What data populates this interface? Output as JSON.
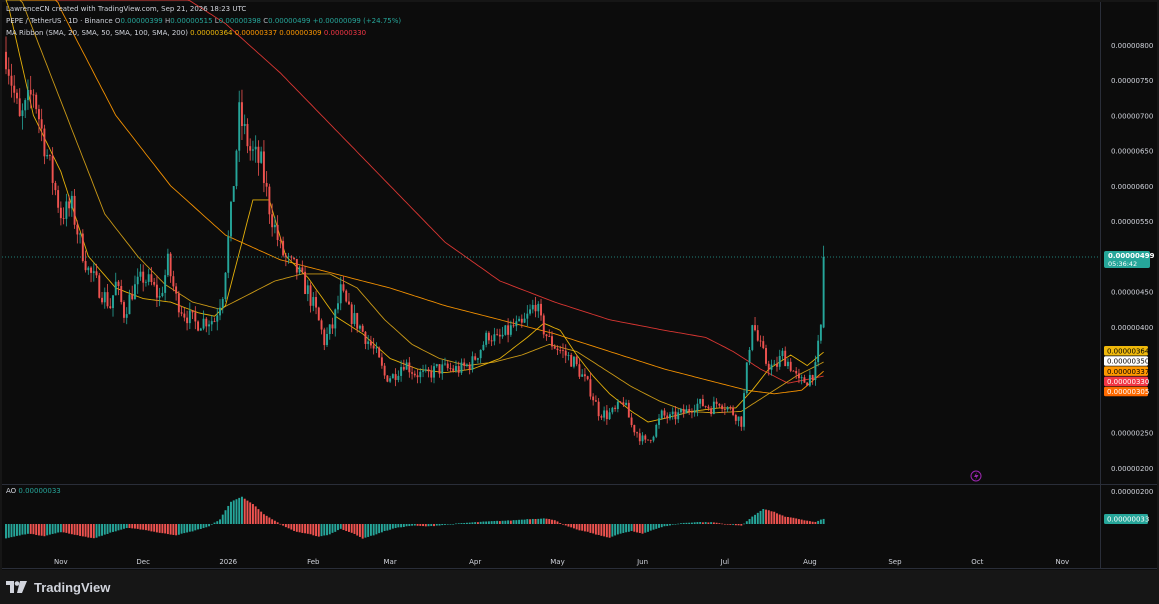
{
  "header": {
    "credit": "LawrenceCN created with TradingView.com, Sep 21, 2026 18:23 UTC",
    "symbol": "PEPE / TetherUS · 1D · Binance",
    "o_label": "O",
    "o_value": "0.00000399",
    "h_label": "H",
    "h_value": "0.00000515",
    "l_label": "L",
    "l_value": "0.00000398",
    "c_label": "C",
    "c_value": "0.00000499",
    "change": "+0.00000099 (+24.75%)",
    "ribbon_name": "MA Ribbon (SMA, 20, SMA, 50, SMA, 100, SMA, 200)",
    "ribbon_v1": "0.00000364",
    "ribbon_v2": "0.00000337",
    "ribbon_v3": "0.00000309",
    "ribbon_v4": "0.00000330"
  },
  "ao": {
    "name": "AO",
    "value": "0.00000033"
  },
  "price_badge": {
    "price": "0.00000499",
    "countdown": "05:36:42"
  },
  "ma_badges": [
    {
      "text": "0.00000364",
      "color": "#f0b90b",
      "price": 3.64
    },
    {
      "text": "0.00000350",
      "color": "#ffffff",
      "price": 3.5
    },
    {
      "text": "0.00000337",
      "color": "#ff9800",
      "price": 3.37
    },
    {
      "text": "0.00000330",
      "color": "#f23645",
      "price": 3.3
    },
    {
      "text": "0.00000305",
      "color": "#ff6a00",
      "price": 3.05
    }
  ],
  "ao_badge": "0.00000033",
  "ao_axis_label": "0.00000200",
  "footer": {
    "brand": "TradingView"
  },
  "colors": {
    "up": "#26a69a",
    "down": "#ef5350",
    "ma20": "#f0b90b",
    "ma50": "#d4a017",
    "ma100": "#ff9800",
    "ma200": "#e53935"
  },
  "chart_data": {
    "type": "candlestick",
    "ylim": [
      1.9,
      8.5
    ],
    "y_unit_note": "prices in units of 0.000001",
    "yticks": [
      {
        "v": 8.0,
        "label": "0.00000800"
      },
      {
        "v": 7.5,
        "label": "0.00000750"
      },
      {
        "v": 7.0,
        "label": "0.00000700"
      },
      {
        "v": 6.5,
        "label": "0.00000650"
      },
      {
        "v": 6.0,
        "label": "0.00000600"
      },
      {
        "v": 5.5,
        "label": "0.00000550"
      },
      {
        "v": 4.5,
        "label": "0.00000450"
      },
      {
        "v": 4.0,
        "label": "0.00000400"
      },
      {
        "v": 2.5,
        "label": "0.00000250"
      },
      {
        "v": 2.0,
        "label": "0.00000200"
      }
    ],
    "xticks": [
      {
        "d": 20,
        "label": "Nov"
      },
      {
        "d": 50,
        "label": "Dec"
      },
      {
        "d": 81,
        "label": "2026"
      },
      {
        "d": 112,
        "label": "Feb"
      },
      {
        "d": 140,
        "label": "Mar"
      },
      {
        "d": 171,
        "label": "Apr"
      },
      {
        "d": 201,
        "label": "May"
      },
      {
        "d": 232,
        "label": "Jun"
      },
      {
        "d": 262,
        "label": "Jul"
      },
      {
        "d": 293,
        "label": "Aug"
      },
      {
        "d": 324,
        "label": "Sep"
      },
      {
        "d": 354,
        "label": "Oct"
      },
      {
        "d": 385,
        "label": "Nov"
      }
    ],
    "price_anchors": [
      [
        0,
        7.9
      ],
      [
        5,
        6.9
      ],
      [
        10,
        7.35
      ],
      [
        14,
        6.6
      ],
      [
        17,
        6.1
      ],
      [
        20,
        5.6
      ],
      [
        24,
        5.7
      ],
      [
        27,
        5.2
      ],
      [
        30,
        4.8
      ],
      [
        34,
        4.55
      ],
      [
        38,
        4.3
      ],
      [
        40,
        4.6
      ],
      [
        43,
        4.2
      ],
      [
        46,
        4.5
      ],
      [
        50,
        4.7
      ],
      [
        53,
        4.6
      ],
      [
        56,
        4.4
      ],
      [
        59,
        4.9
      ],
      [
        62,
        4.4
      ],
      [
        65,
        4.2
      ],
      [
        69,
        4.05
      ],
      [
        73,
        4.1
      ],
      [
        76,
        4.1
      ],
      [
        79,
        4.5
      ],
      [
        82,
        5.6
      ],
      [
        85,
        7.0
      ],
      [
        89,
        6.5
      ],
      [
        93,
        6.3
      ],
      [
        96,
        5.7
      ],
      [
        100,
        5.1
      ],
      [
        103,
        4.9
      ],
      [
        106,
        4.8
      ],
      [
        110,
        4.5
      ],
      [
        113,
        4.2
      ],
      [
        116,
        3.8
      ],
      [
        119,
        4.0
      ],
      [
        122,
        4.5
      ],
      [
        125,
        4.2
      ],
      [
        129,
        4.0
      ],
      [
        132,
        3.8
      ],
      [
        135,
        3.6
      ],
      [
        138,
        3.3
      ],
      [
        141,
        3.3
      ],
      [
        145,
        3.5
      ],
      [
        149,
        3.35
      ],
      [
        153,
        3.3
      ],
      [
        157,
        3.4
      ],
      [
        162,
        3.4
      ],
      [
        166,
        3.4
      ],
      [
        170,
        3.5
      ],
      [
        173,
        3.7
      ],
      [
        176,
        3.9
      ],
      [
        179,
        3.8
      ],
      [
        182,
        3.9
      ],
      [
        185,
        4.0
      ],
      [
        188,
        4.0
      ],
      [
        191,
        4.2
      ],
      [
        193,
        4.35
      ],
      [
        195,
        4.05
      ],
      [
        198,
        3.8
      ],
      [
        201,
        3.7
      ],
      [
        204,
        3.6
      ],
      [
        207,
        3.5
      ],
      [
        210,
        3.3
      ],
      [
        213,
        3.1
      ],
      [
        216,
        2.8
      ],
      [
        219,
        2.75
      ],
      [
        222,
        2.8
      ],
      [
        225,
        2.95
      ],
      [
        228,
        2.6
      ],
      [
        231,
        2.45
      ],
      [
        233,
        2.35
      ],
      [
        236,
        2.5
      ],
      [
        239,
        2.75
      ],
      [
        242,
        2.7
      ],
      [
        245,
        2.75
      ],
      [
        248,
        2.8
      ],
      [
        251,
        2.9
      ],
      [
        254,
        2.9
      ],
      [
        257,
        2.85
      ],
      [
        260,
        2.95
      ],
      [
        263,
        2.85
      ],
      [
        266,
        2.75
      ],
      [
        268,
        2.65
      ],
      [
        270,
        3.4
      ],
      [
        272,
        4.1
      ],
      [
        274,
        3.8
      ],
      [
        277,
        3.5
      ],
      [
        280,
        3.4
      ],
      [
        283,
        3.6
      ],
      [
        286,
        3.45
      ],
      [
        289,
        3.2
      ],
      [
        292,
        3.25
      ],
      [
        295,
        3.4
      ],
      [
        297,
        4.0
      ],
      [
        298,
        4.99
      ]
    ],
    "ma20_anchors": [
      [
        0,
        8.7
      ],
      [
        10,
        7.0
      ],
      [
        20,
        6.2
      ],
      [
        30,
        5.0
      ],
      [
        40,
        4.55
      ],
      [
        50,
        4.4
      ],
      [
        60,
        4.35
      ],
      [
        70,
        4.2
      ],
      [
        76,
        4.15
      ],
      [
        80,
        4.3
      ],
      [
        86,
        5.2
      ],
      [
        90,
        5.8
      ],
      [
        96,
        5.8
      ],
      [
        102,
        5.0
      ],
      [
        110,
        4.7
      ],
      [
        120,
        4.15
      ],
      [
        130,
        3.9
      ],
      [
        140,
        3.55
      ],
      [
        150,
        3.4
      ],
      [
        160,
        3.35
      ],
      [
        170,
        3.4
      ],
      [
        180,
        3.55
      ],
      [
        190,
        3.85
      ],
      [
        196,
        4.05
      ],
      [
        202,
        3.95
      ],
      [
        208,
        3.6
      ],
      [
        214,
        3.3
      ],
      [
        220,
        3.05
      ],
      [
        228,
        2.8
      ],
      [
        234,
        2.65
      ],
      [
        240,
        2.7
      ],
      [
        250,
        2.8
      ],
      [
        260,
        2.85
      ],
      [
        266,
        2.85
      ],
      [
        272,
        3.1
      ],
      [
        278,
        3.4
      ],
      [
        286,
        3.6
      ],
      [
        292,
        3.45
      ],
      [
        298,
        3.64
      ]
    ],
    "ma50_anchors": [
      [
        0,
        9.2
      ],
      [
        12,
        8.0
      ],
      [
        24,
        6.8
      ],
      [
        36,
        5.6
      ],
      [
        48,
        5.0
      ],
      [
        58,
        4.6
      ],
      [
        68,
        4.35
      ],
      [
        78,
        4.25
      ],
      [
        88,
        4.45
      ],
      [
        98,
        4.65
      ],
      [
        108,
        4.75
      ],
      [
        118,
        4.75
      ],
      [
        128,
        4.55
      ],
      [
        138,
        4.1
      ],
      [
        148,
        3.75
      ],
      [
        158,
        3.55
      ],
      [
        168,
        3.45
      ],
      [
        178,
        3.5
      ],
      [
        188,
        3.6
      ],
      [
        198,
        3.75
      ],
      [
        208,
        3.65
      ],
      [
        218,
        3.4
      ],
      [
        228,
        3.15
      ],
      [
        238,
        2.95
      ],
      [
        248,
        2.8
      ],
      [
        258,
        2.78
      ],
      [
        268,
        2.8
      ],
      [
        278,
        3.05
      ],
      [
        288,
        3.3
      ],
      [
        298,
        3.5
      ]
    ],
    "ma100_anchors": [
      [
        0,
        10.5
      ],
      [
        20,
        8.5
      ],
      [
        40,
        7.0
      ],
      [
        60,
        6.0
      ],
      [
        80,
        5.3
      ],
      [
        100,
        4.95
      ],
      [
        120,
        4.75
      ],
      [
        140,
        4.55
      ],
      [
        160,
        4.3
      ],
      [
        180,
        4.1
      ],
      [
        200,
        3.9
      ],
      [
        220,
        3.65
      ],
      [
        240,
        3.4
      ],
      [
        260,
        3.2
      ],
      [
        270,
        3.1
      ],
      [
        280,
        3.05
      ],
      [
        290,
        3.1
      ],
      [
        298,
        3.37
      ]
    ],
    "ma200_anchors": [
      [
        0,
        9.8
      ],
      [
        30,
        9.4
      ],
      [
        60,
        8.8
      ],
      [
        80,
        8.3
      ],
      [
        100,
        7.6
      ],
      [
        120,
        6.8
      ],
      [
        140,
        6.0
      ],
      [
        160,
        5.2
      ],
      [
        180,
        4.65
      ],
      [
        200,
        4.35
      ],
      [
        220,
        4.1
      ],
      [
        240,
        3.95
      ],
      [
        255,
        3.85
      ],
      [
        265,
        3.65
      ],
      [
        275,
        3.4
      ],
      [
        285,
        3.2
      ],
      [
        298,
        3.3
      ]
    ],
    "ao_anchors": [
      [
        0,
        -0.9
      ],
      [
        8,
        -0.6
      ],
      [
        14,
        -0.75
      ],
      [
        20,
        -0.5
      ],
      [
        26,
        -0.7
      ],
      [
        32,
        -0.9
      ],
      [
        38,
        -0.55
      ],
      [
        44,
        -0.25
      ],
      [
        50,
        -0.35
      ],
      [
        56,
        -0.55
      ],
      [
        62,
        -0.7
      ],
      [
        68,
        -0.45
      ],
      [
        74,
        -0.15
      ],
      [
        78,
        0.3
      ],
      [
        82,
        1.4
      ],
      [
        86,
        1.7
      ],
      [
        90,
        1.25
      ],
      [
        94,
        0.6
      ],
      [
        98,
        0.2
      ],
      [
        102,
        -0.2
      ],
      [
        106,
        -0.5
      ],
      [
        110,
        -0.6
      ],
      [
        114,
        -0.8
      ],
      [
        118,
        -0.65
      ],
      [
        122,
        -0.3
      ],
      [
        126,
        -0.55
      ],
      [
        130,
        -0.9
      ],
      [
        134,
        -0.7
      ],
      [
        138,
        -0.45
      ],
      [
        142,
        -0.25
      ],
      [
        148,
        -0.1
      ],
      [
        154,
        -0.15
      ],
      [
        160,
        -0.05
      ],
      [
        166,
        0.05
      ],
      [
        172,
        0.12
      ],
      [
        178,
        0.18
      ],
      [
        184,
        0.22
      ],
      [
        190,
        0.3
      ],
      [
        196,
        0.35
      ],
      [
        200,
        0.25
      ],
      [
        204,
        -0.1
      ],
      [
        208,
        -0.35
      ],
      [
        212,
        -0.5
      ],
      [
        216,
        -0.7
      ],
      [
        220,
        -0.85
      ],
      [
        224,
        -0.6
      ],
      [
        228,
        -0.45
      ],
      [
        232,
        -0.6
      ],
      [
        236,
        -0.35
      ],
      [
        240,
        -0.15
      ],
      [
        246,
        0.05
      ],
      [
        252,
        0.12
      ],
      [
        258,
        0.1
      ],
      [
        264,
        -0.05
      ],
      [
        268,
        -0.1
      ],
      [
        272,
        0.45
      ],
      [
        276,
        0.95
      ],
      [
        280,
        0.75
      ],
      [
        284,
        0.45
      ],
      [
        288,
        0.35
      ],
      [
        292,
        0.2
      ],
      [
        295,
        0.12
      ],
      [
        298,
        0.33
      ]
    ]
  }
}
